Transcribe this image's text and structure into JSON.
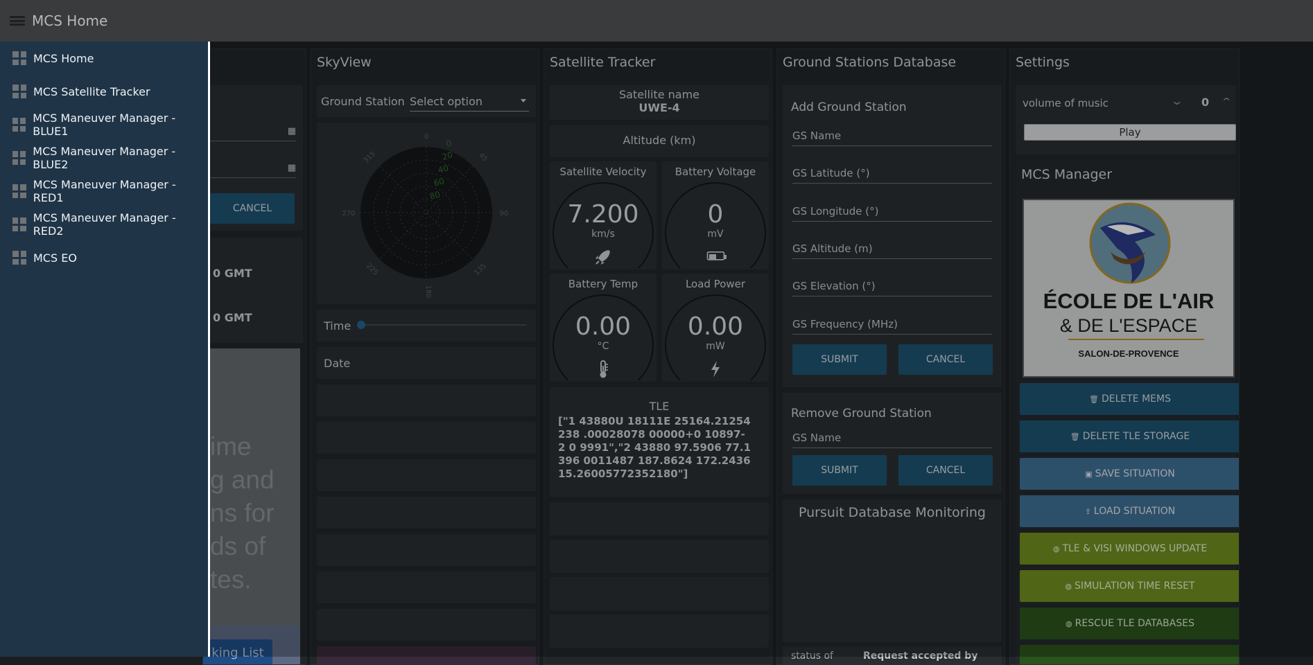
{
  "topbar": {
    "title": "MCS Home"
  },
  "sidebar": {
    "items": [
      {
        "label": "MCS Home"
      },
      {
        "label": "MCS Satellite Tracker"
      },
      {
        "label": "MCS Maneuver Manager - BLUE1"
      },
      {
        "label": "MCS Maneuver Manager - BLUE2"
      },
      {
        "label": "MCS Maneuver Manager - RED1"
      },
      {
        "label": "MCS Maneuver Manager - RED2"
      },
      {
        "label": "MCS EO"
      }
    ]
  },
  "left_panel": {
    "cancel_label": "CANCEL",
    "gmt_1": "0 GMT",
    "gmt_2": "0 GMT",
    "banner_lines": [
      "ime",
      "g and",
      "ns for",
      "ds of",
      "tes."
    ],
    "tracking_button": "king List"
  },
  "skyview": {
    "title": "SkyView",
    "ground_station_label": "Ground Station",
    "select_placeholder": "Select option",
    "polar": {
      "elevation_labels": [
        "0",
        "20",
        "40",
        "60",
        "80"
      ],
      "azimuth_labels": [
        "0",
        "45",
        "90",
        "135",
        "180",
        "225",
        "270",
        "315"
      ]
    },
    "time_label": "Time",
    "date_label": "Date"
  },
  "tracker": {
    "title": "Satellite Tracker",
    "satellite_name_label": "Satellite name",
    "satellite_name_value": "UWE-4",
    "altitude_label": "Altitude (km)",
    "gauges": [
      {
        "title": "Satellite Velocity",
        "value": "7.200",
        "unit": "km/s",
        "icon": "rocket-icon"
      },
      {
        "title": "Battery Voltage",
        "value": "0",
        "unit": "mV",
        "icon": "battery-icon"
      },
      {
        "title": "Battery Temp",
        "value": "0.00",
        "unit": "°C",
        "icon": "thermometer-icon"
      },
      {
        "title": "Load Power",
        "value": "0.00",
        "unit": "mW",
        "icon": "bolt-icon"
      }
    ],
    "tle_label": "TLE",
    "tle_value": "[\"1 43880U 18111E 25164.21254238 .00028078 00000+0 10897-2 0 9991\",\"2 43880 97.5906 77.1396 0011487 187.8624 172.2436 15.26005772352180\"]"
  },
  "gsdb": {
    "title": "Ground Stations Database",
    "add_title": "Add Ground Station",
    "fields": [
      "GS Name",
      "GS Latitude (°)",
      "GS Longitude (°)",
      "GS Altitude (m)",
      "GS Elevation (°)",
      "GS Frequency (MHz)"
    ],
    "submit_label": "SUBMIT",
    "cancel_label": "CANCEL",
    "remove_title": "Remove Ground Station",
    "remove_field": "GS Name",
    "remove_submit": "SUBMIT",
    "remove_cancel": "CANCEL",
    "pursuit_title": "Pursuit Database Monitoring",
    "status_label": "status of",
    "status_value": "Request accepted by"
  },
  "settings": {
    "title": "Settings",
    "volume_label": "volume of music",
    "volume_value": "0",
    "play_label": "Play",
    "manager_title": "MCS Manager",
    "logo_text": {
      "line1": "ÉCOLE DE L'AIR",
      "line2": "& DE L'ESPACE",
      "line3": "SALON-DE-PROVENCE"
    },
    "buttons": [
      {
        "label": "DELETE MEMS",
        "icon": "trash-icon",
        "style": "blue"
      },
      {
        "label": "DELETE TLE STORAGE",
        "icon": "trash-icon",
        "style": "blue"
      },
      {
        "label": "SAVE SITUATION",
        "icon": "save-icon",
        "style": "mid"
      },
      {
        "label": "LOAD SITUATION",
        "icon": "upload-icon",
        "style": "mid"
      },
      {
        "label": "TLE & VISI WINDOWS UPDATE",
        "icon": "globe-icon",
        "style": "green"
      },
      {
        "label": "SIMULATION TIME RESET",
        "icon": "globe-icon",
        "style": "green"
      },
      {
        "label": "RESCUE TLE DATABASES",
        "icon": "globe-icon",
        "style": "dgreen"
      }
    ]
  },
  "colors": {
    "sidebar": "#1f3447",
    "topbar": "#393b3d",
    "button_blue": "#1c5270",
    "button_green": "#6f8d1f"
  }
}
